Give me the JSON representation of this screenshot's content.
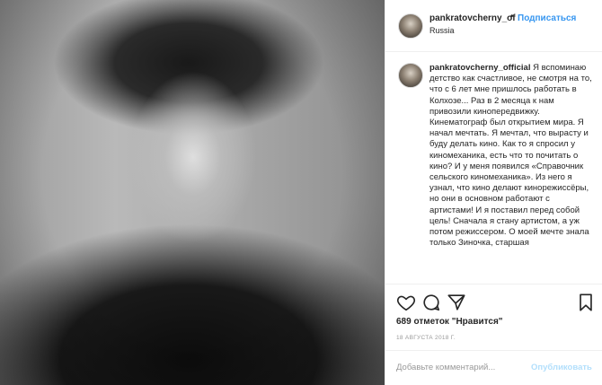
{
  "post": {
    "username": "pankratovcherny_of",
    "separator": "•",
    "follow_label": "Подписаться",
    "location": "Russia"
  },
  "caption": {
    "username": "pankratovcherny_official",
    "text": "Я вспоминаю детство как счастливое, не смотря на то, что с 6 лет мне пришлось работать в Колхозе... Раз в 2 месяца к нам привозили кинопередвижку. Кинематограф был открытием мира. Я начал мечтать. Я мечтал, что вырасту и буду делать кино. Как то я спросил у киномеханика, есть что то почитать о кино? И у меня появился «Справочник сельского киномеханика». Из него я узнал, что кино делают кинорежиссёры, но они в основном работают с артистами! И я поставил перед собой цель! Сначала я стану артистом, а уж потом режиссером. О моей мечте знала только Зиночка, старшая"
  },
  "icons": {
    "like": "heart-icon",
    "comment": "comment-icon",
    "share": "share-icon",
    "save": "bookmark-icon"
  },
  "likes_text": "689 отметок \"Нравится\"",
  "date_text": "18 АВГУСТА 2018 Г.",
  "comment_box": {
    "placeholder": "Добавьте комментарий...",
    "publish_label": "Опубликовать"
  },
  "colors": {
    "link_blue": "#3897f0",
    "publish_disabled": "#b2dffc",
    "muted_gray": "#999999"
  }
}
